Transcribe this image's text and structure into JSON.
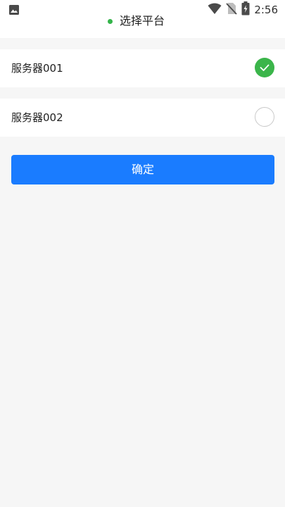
{
  "status_bar": {
    "time": "2:56",
    "icons": [
      "image-icon",
      "wifi-icon",
      "no-sim-icon",
      "battery-charging-icon"
    ]
  },
  "header": {
    "title": "选择平台",
    "indicator_color": "#34b44a"
  },
  "servers": [
    {
      "label": "服务器001",
      "selected": true
    },
    {
      "label": "服务器002",
      "selected": false
    }
  ],
  "confirm": {
    "label": "确定",
    "color": "#1a7cff"
  }
}
